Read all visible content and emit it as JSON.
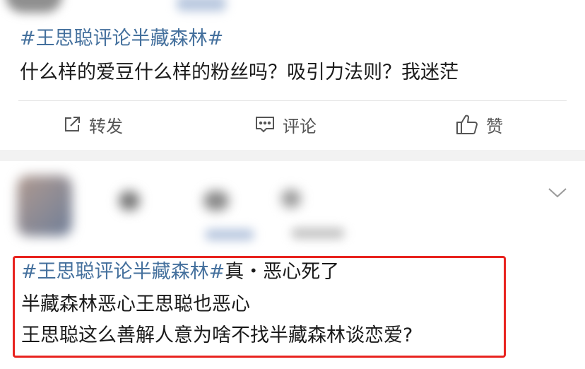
{
  "post1": {
    "topic": "#王思聪评论半藏森林#",
    "text": "什么样的爱豆什么样的粉丝吗？吸引力法则？我迷茫"
  },
  "actions": {
    "repost_label": "转发",
    "comment_label": "评论",
    "like_label": "赞"
  },
  "post2": {
    "line1_topic": "#王思聪评论半藏森林#",
    "line1_rest": "真・恶心死了",
    "line2": "半藏森林恶心王思聪也恶心",
    "line3": "王思聪这么善解人意为啥不找半藏森林谈恋爱?"
  },
  "colors": {
    "topic": "#44709d",
    "highlight_border": "#e8231f",
    "text": "#1a1a1a",
    "action_text": "#555555"
  },
  "icons": [
    "share-icon",
    "comment-icon",
    "thumbs-up-icon",
    "chevron-down-icon"
  ]
}
